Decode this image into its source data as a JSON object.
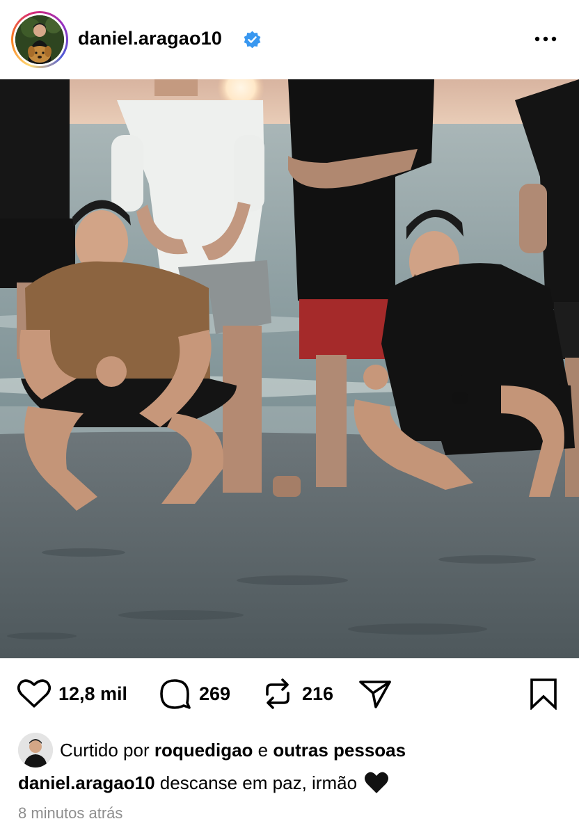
{
  "header": {
    "username": "daniel.aragao10",
    "verified": true,
    "more_icon": "more-horizontal-icon"
  },
  "photo": {
    "icon": "photo"
  },
  "actions": {
    "like_count": "12,8 mil",
    "comment_count": "269",
    "repost_count": "216",
    "icons": [
      "heart-icon",
      "comment-icon",
      "repost-icon",
      "share-icon",
      "bookmark-icon"
    ]
  },
  "likes": {
    "prefix": "Curtido por",
    "user": "roquedigao",
    "joiner": "e",
    "others": "outras pessoas"
  },
  "caption": {
    "username": "daniel.aragao10",
    "text": "descanse em paz, irmão"
  },
  "timestamp": "8 minutos atrás",
  "colors": {
    "verified_blue": "#3897f0",
    "text": "#000000",
    "muted": "#8e8e8e"
  }
}
